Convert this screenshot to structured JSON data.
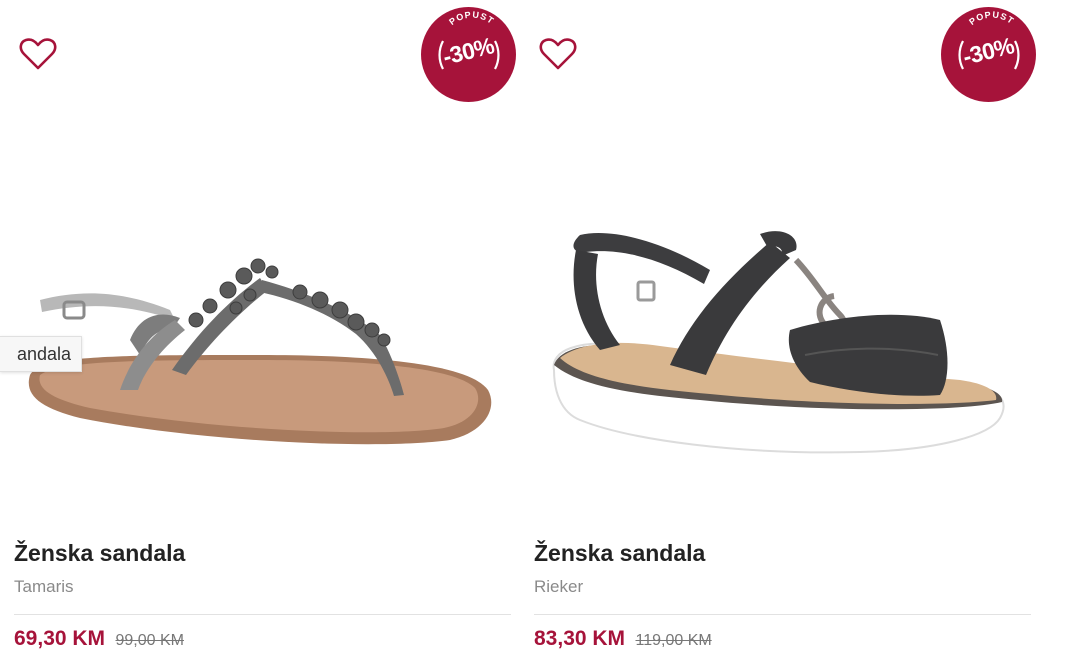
{
  "colors": {
    "accent": "#a6133a",
    "text": "#222222",
    "muted": "#8a8a8a"
  },
  "products": [
    {
      "title": "Ženska sandala",
      "brand": "Tamaris",
      "price": "69,30 KM",
      "old_price": "99,00 KM",
      "badge": {
        "label": "POPUST",
        "discount": "-30%"
      },
      "wishlist_icon": "heart-outline-icon"
    },
    {
      "title": "Ženska sandala",
      "brand": "Rieker",
      "price": "83,30 KM",
      "old_price": "119,00 KM",
      "badge": {
        "label": "POPUST",
        "discount": "-30%"
      },
      "wishlist_icon": "heart-outline-icon"
    }
  ],
  "tooltip": {
    "text": "andala"
  }
}
